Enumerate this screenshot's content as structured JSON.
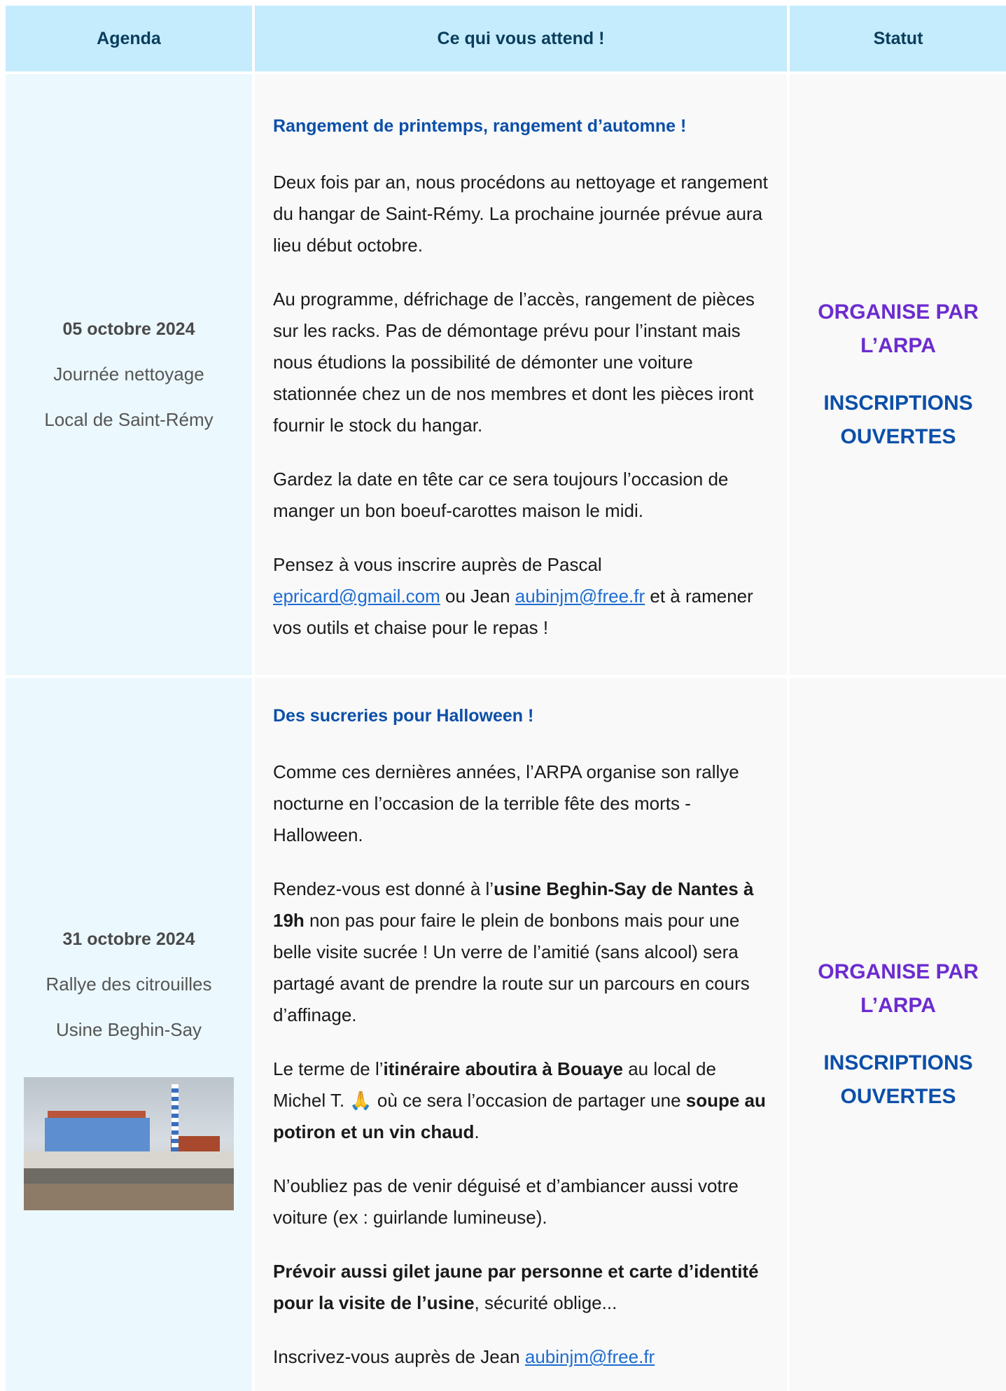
{
  "header": {
    "agenda": "Agenda",
    "content": "Ce qui vous attend !",
    "status": "Statut"
  },
  "events": [
    {
      "date": "05 octobre 2024",
      "title": "Journée nettoyage",
      "location": "Local de Saint-Rémy",
      "heading": "Rangement de printemps, rangement d’automne !",
      "p1": "Deux fois par an, nous procédons au nettoyage et rangement du hangar de Saint-Rémy. La prochaine journée prévue aura lieu début octobre.",
      "p2": "Au programme, défrichage de l’accès, rangement de pièces sur les racks. Pas de démontage prévu pour l’instant mais nous étudions la possibilité de démonter une voiture stationnée chez un de nos membres et dont les pièces iront fournir le stock du hangar.",
      "p3": "Gardez la date en tête car ce sera toujours l’occasion de manger un bon boeuf-carottes maison le midi.",
      "p4_a": "Pensez à vous inscrire auprès de Pascal ",
      "email1": "epricard@gmail.com",
      "p4_b": " ou Jean ",
      "email2": "aubinjm@free.fr",
      "p4_c": " et à ramener vos outils et chaise pour le repas !",
      "status_org": "ORGANISE PAR L’ARPA",
      "status_insc": "INSCRIPTIONS OUVERTES"
    },
    {
      "date": "31 octobre 2024",
      "title": "Rallye des citrouilles",
      "location": "Usine Beghin-Say",
      "heading": "Des sucreries pour Halloween !",
      "p1": "Comme ces dernières années, l’ARPA organise son rallye nocturne en l’occasion de la terrible fête des morts - Halloween.",
      "p2_a": "Rendez-vous est donné à l’",
      "p2_b": "usine Beghin-Say de Nantes à 19h",
      "p2_c": " non pas pour faire le plein de bonbons mais pour une belle visite sucrée ! Un verre de l’amitié (sans alcool) sera partagé avant de prendre la route sur un parcours en cours d’affinage.",
      "p3_a": "Le terme de l’",
      "p3_b": "itinéraire aboutira à Bouaye",
      "p3_c": " au local de Michel T. 🙏 où ce sera l’occasion de partager une ",
      "p3_d": "soupe au potiron et un vin chaud",
      "p3_e": ".",
      "p4": "N’oubliez pas de venir déguisé et d’ambiancer aussi votre voiture (ex : guirlande lumineuse).",
      "p5_a": "Prévoir aussi gilet jaune par personne et carte d’identité pour la visite de l’usine",
      "p5_b": ", sécurité oblige...",
      "p6_a": "Inscrivez-vous auprès de Jean ",
      "email": "aubinjm@free.fr",
      "status_org": "ORGANISE PAR L’ARPA",
      "status_insc": "INSCRIPTIONS OUVERTES"
    }
  ]
}
